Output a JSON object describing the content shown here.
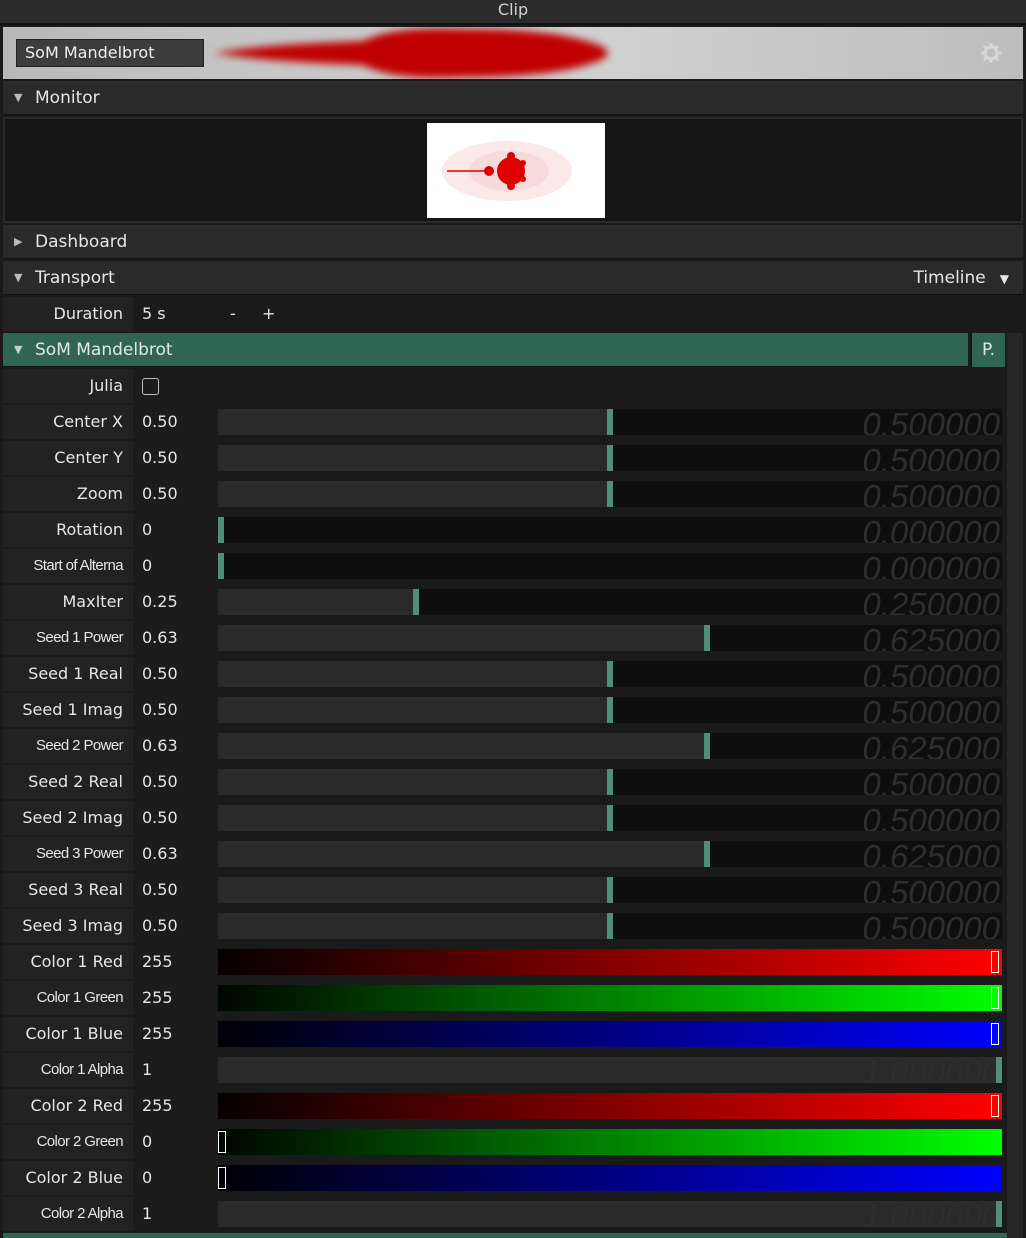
{
  "window": {
    "title": "Clip"
  },
  "clip": {
    "name": "SoM Mandelbrot"
  },
  "sections": {
    "monitor": "Monitor",
    "dashboard": "Dashboard",
    "transport": "Transport",
    "transport_mode": "Timeline"
  },
  "duration": {
    "label": "Duration",
    "value": "5 s",
    "minus": "-",
    "plus": "+"
  },
  "effect": {
    "title": "SoM Mandelbrot",
    "p_button": "P."
  },
  "julia": {
    "label": "Julia",
    "checked": false
  },
  "params": [
    {
      "label": "Center X",
      "value": "0.50",
      "level": 0.5,
      "ghost": "0.500000"
    },
    {
      "label": "Center Y",
      "value": "0.50",
      "level": 0.5,
      "ghost": "0.500000"
    },
    {
      "label": "Zoom",
      "value": "0.50",
      "level": 0.5,
      "ghost": "0.500000"
    },
    {
      "label": "Rotation",
      "value": "0",
      "level": 0,
      "ghost": "0.000000"
    },
    {
      "label": "Start of Alterna",
      "value": "0",
      "level": 0,
      "ghost": "0.000000",
      "condensed": true
    },
    {
      "label": "MaxIter",
      "value": "0.25",
      "level": 0.25,
      "ghost": "0.250000"
    },
    {
      "label": "Seed 1 Power",
      "value": "0.63",
      "level": 0.625,
      "ghost": "0.625000",
      "condensed": true
    },
    {
      "label": "Seed 1 Real",
      "value": "0.50",
      "level": 0.5,
      "ghost": "0.500000"
    },
    {
      "label": "Seed 1 Imag",
      "value": "0.50",
      "level": 0.5,
      "ghost": "0.500000"
    },
    {
      "label": "Seed 2 Power",
      "value": "0.63",
      "level": 0.625,
      "ghost": "0.625000",
      "condensed": true
    },
    {
      "label": "Seed 2 Real",
      "value": "0.50",
      "level": 0.5,
      "ghost": "0.500000"
    },
    {
      "label": "Seed 2 Imag",
      "value": "0.50",
      "level": 0.5,
      "ghost": "0.500000"
    },
    {
      "label": "Seed 3 Power",
      "value": "0.63",
      "level": 0.625,
      "ghost": "0.625000",
      "condensed": true
    },
    {
      "label": "Seed 3 Real",
      "value": "0.50",
      "level": 0.5,
      "ghost": "0.500000"
    },
    {
      "label": "Seed 3 Imag",
      "value": "0.50",
      "level": 0.5,
      "ghost": "0.500000"
    },
    {
      "label": "Color 1 Red",
      "value": "255",
      "level": 1,
      "color": "#ff0000"
    },
    {
      "label": "Color 1 Green",
      "value": "255",
      "level": 1,
      "color": "#00ff00",
      "condensed": true
    },
    {
      "label": "Color 1 Blue",
      "value": "255",
      "level": 1,
      "color": "#0000ff"
    },
    {
      "label": "Color 1 Alpha",
      "value": "1",
      "level": 1,
      "ghost": "1.000000",
      "condensed": true
    },
    {
      "label": "Color 2 Red",
      "value": "255",
      "level": 1,
      "color": "#ff0000"
    },
    {
      "label": "Color 2 Green",
      "value": "0",
      "level": 0,
      "color": "#00ff00",
      "condensed": true
    },
    {
      "label": "Color 2 Blue",
      "value": "0",
      "level": 0,
      "color": "#0000ff"
    },
    {
      "label": "Color 2 Alpha",
      "value": "1",
      "level": 1,
      "ghost": "1.000000",
      "condensed": true
    }
  ],
  "colors": {
    "accent": "#2e6553",
    "thumb": "#4f8f77"
  }
}
